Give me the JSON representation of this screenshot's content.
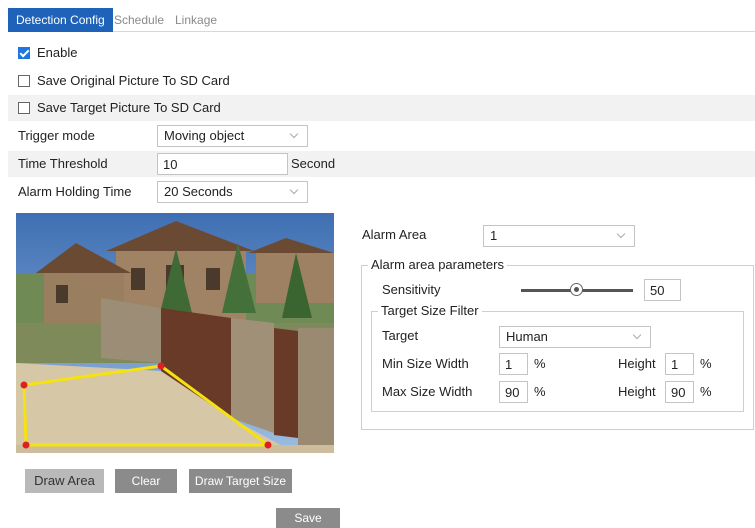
{
  "tabs": [
    {
      "label": "Detection Config",
      "active": true
    },
    {
      "label": "Schedule",
      "active": false
    },
    {
      "label": "Linkage",
      "active": false
    }
  ],
  "enable": {
    "label": "Enable",
    "checked": true
  },
  "save_original": {
    "label": "Save Original Picture To SD Card",
    "checked": false
  },
  "save_target": {
    "label": "Save Target Picture To SD Card",
    "checked": false
  },
  "trigger_mode": {
    "label": "Trigger mode",
    "value": "Moving object"
  },
  "time_threshold": {
    "label": "Time Threshold",
    "value": "10",
    "unit": "Second"
  },
  "alarm_holding": {
    "label": "Alarm Holding Time",
    "value": "20 Seconds"
  },
  "alarm_area": {
    "label": "Alarm Area",
    "value": "1"
  },
  "params": {
    "title": "Alarm area parameters",
    "sensitivity_label": "Sensitivity",
    "sensitivity_value": "50",
    "sensitivity_level": 0.5
  },
  "target_filter": {
    "title": "Target Size Filter",
    "target_label": "Target",
    "target_value": "Human",
    "min_width_label": "Min Size Width",
    "min_width": "1",
    "max_width_label": "Max Size Width",
    "max_width": "90",
    "height_label": "Height",
    "min_height": "1",
    "max_height": "90",
    "percent": "%"
  },
  "buttons": {
    "draw_area": "Draw Area",
    "clear": "Clear",
    "draw_target": "Draw Target Size",
    "save": "Save"
  },
  "colors": {
    "accent": "#1e63b9",
    "zone_line": "#f5e20f",
    "zone_vertex": "#e02020"
  }
}
